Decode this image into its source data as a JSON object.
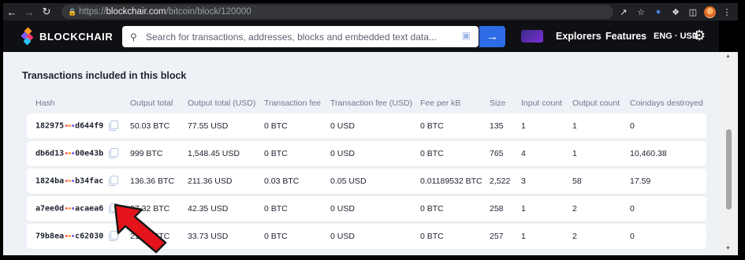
{
  "browser": {
    "url_scheme": "https://",
    "url_host": "blockchair.com",
    "url_path": "/bitcoin/block/120000"
  },
  "header": {
    "logo_text": "BLOCKCHAIR",
    "search_placeholder": "Search for transactions, addresses, blocks and embedded text data...",
    "nav": [
      "Explorers",
      "Features",
      "ENG · USD"
    ]
  },
  "section": {
    "title": "Transactions included in this block"
  },
  "table": {
    "columns": [
      "Hash",
      "Output total",
      "Output total (USD)",
      "Transaction fee",
      "Transaction fee (USD)",
      "Fee per kB",
      "Size",
      "Input count",
      "Output count",
      "Coindays destroyed"
    ],
    "rows": [
      {
        "hash_start": "182975",
        "hash_end": "d644f9",
        "output_total": "50.03 BTC",
        "output_usd": "77.55 USD",
        "fee": "0 BTC",
        "fee_usd": "0 USD",
        "fee_per_kb": "0 BTC",
        "size": "135",
        "inputs": "1",
        "outputs": "1",
        "coindays": "0"
      },
      {
        "hash_start": "db6d13",
        "hash_end": "00e43b",
        "output_total": "999 BTC",
        "output_usd": "1,548.45 USD",
        "fee": "0 BTC",
        "fee_usd": "0 USD",
        "fee_per_kb": "0 BTC",
        "size": "765",
        "inputs": "4",
        "outputs": "1",
        "coindays": "10,460.38"
      },
      {
        "hash_start": "1824ba",
        "hash_end": "b34fac",
        "output_total": "136.36 BTC",
        "output_usd": "211.36 USD",
        "fee": "0.03 BTC",
        "fee_usd": "0.05 USD",
        "fee_per_kb": "0.01189532 BTC",
        "size": "2,522",
        "inputs": "3",
        "outputs": "58",
        "coindays": "17.59"
      },
      {
        "hash_start": "a7ee0d",
        "hash_end": "acaea6",
        "output_total": "27.32 BTC",
        "output_usd": "42.35 USD",
        "fee": "0 BTC",
        "fee_usd": "0 USD",
        "fee_per_kb": "0 BTC",
        "size": "258",
        "inputs": "1",
        "outputs": "2",
        "coindays": "0"
      },
      {
        "hash_start": "79b8ea",
        "hash_end": "c62030",
        "output_total": "21.76 BTC",
        "output_usd": "33.73 USD",
        "fee": "0 BTC",
        "fee_usd": "0 USD",
        "fee_per_kb": "0 BTC",
        "size": "257",
        "inputs": "1",
        "outputs": "2",
        "coindays": "0"
      }
    ]
  },
  "colors": {
    "accent": "#2e6be6",
    "header_bg": "#0f1014",
    "page_bg": "#eef1f6",
    "annotation_arrow": "#e5141b"
  }
}
